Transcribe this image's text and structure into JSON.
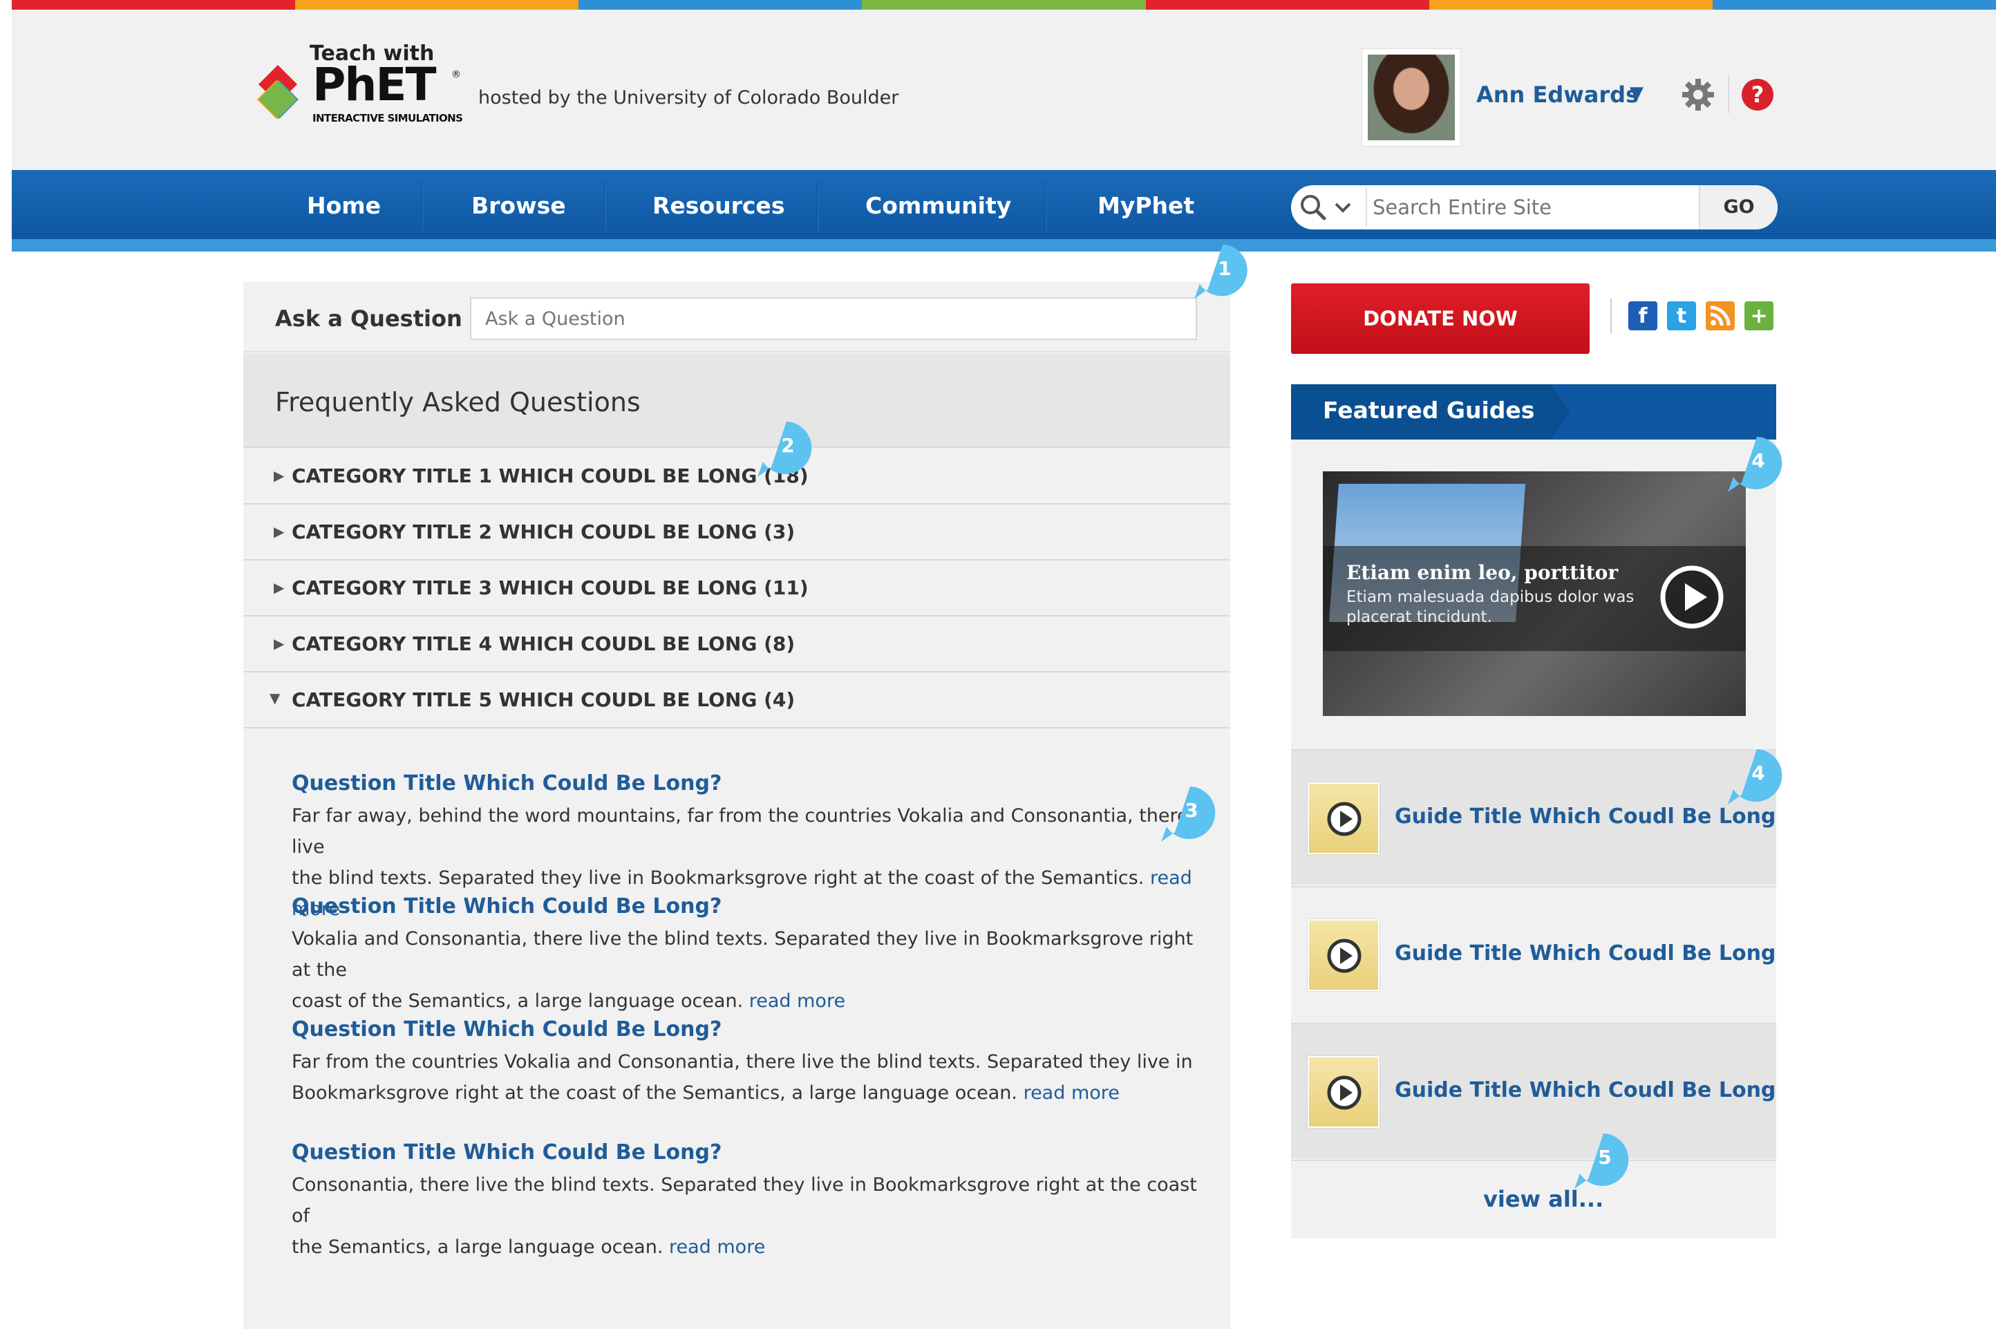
{
  "stripe_colors": [
    "#e2232b",
    "#f7a21b",
    "#2f8fd6",
    "#7ab842",
    "#e2232b",
    "#f7a21b",
    "#2f8fd6"
  ],
  "header": {
    "teach_with": "Teach with",
    "phet": "PhET",
    "reg": "®",
    "sub": "INTERACTIVE SIMULATIONS",
    "hosted_by": "hosted by the University of Colorado Boulder",
    "user_name": "Ann Edwards",
    "user_caret": "▼",
    "help": "?"
  },
  "nav": {
    "items": [
      "Home",
      "Browse",
      "Resources",
      "Community",
      "MyPhet"
    ],
    "search_placeholder": "Search Entire Site",
    "go": "GO"
  },
  "ask": {
    "label": "Ask a Question",
    "placeholder": "Ask a Question"
  },
  "faq": {
    "title": "Frequently Asked Questions",
    "categories": [
      {
        "title": "CATEGORY TITLE 1 WHICH COUDL BE LONG (18)",
        "expanded": false
      },
      {
        "title": "CATEGORY TITLE 2 WHICH COUDL BE LONG (3)",
        "expanded": false
      },
      {
        "title": "CATEGORY TITLE 3 WHICH COUDL BE LONG (11)",
        "expanded": false
      },
      {
        "title": "CATEGORY TITLE 4 WHICH COUDL BE LONG (8)",
        "expanded": false
      },
      {
        "title": "CATEGORY TITLE 5 WHICH COUDL BE LONG (4)",
        "expanded": true
      }
    ],
    "questions": [
      {
        "title": "Question Title Which Could Be Long?",
        "body_line1": "Far far away, behind the word mountains, far from the countries Vokalia and Consonantia, there live",
        "body_line2": "the blind texts. Separated they live in Bookmarksgrove right at the coast of the Semantics.",
        "more": "read more"
      },
      {
        "title": "Question Title Which Could Be Long?",
        "body_line1": "Vokalia and Consonantia, there live the blind texts. Separated they live in Bookmarksgrove right at the",
        "body_line2": "coast of the Semantics, a large language ocean.",
        "more": "read more"
      },
      {
        "title": "Question Title Which Could Be Long?",
        "body_line1": "Far from the countries Vokalia and Consonantia, there live the blind texts. Separated they live in",
        "body_line2": "Bookmarksgrove right at the coast of the Semantics, a large language ocean.",
        "more": "read more"
      },
      {
        "title": "Question Title Which Could Be Long?",
        "body_line1": "Consonantia, there live the blind texts. Separated they live in Bookmarksgrove right at the coast of",
        "body_line2": "the Semantics, a large language ocean.",
        "more": "read more"
      }
    ]
  },
  "sidebar": {
    "donate": "DONATE NOW",
    "social_icons": [
      "facebook-icon",
      "twitter-icon",
      "rss-icon",
      "plus-icon"
    ],
    "social_glyphs": [
      "f",
      "t",
      "",
      "+"
    ],
    "featured_title": "Featured Guides",
    "video": {
      "title": "Etiam enim leo, porttitor",
      "desc": "Etiam malesuada dapibus dolor was placerat tincidunt."
    },
    "guides": [
      "Guide Title Which Coudl Be Long",
      "Guide Title Which Coudl Be Long",
      "Guide Title Which Coudl Be Long"
    ],
    "view_all": "view all..."
  },
  "callouts": [
    "1",
    "2",
    "3",
    "4",
    "4",
    "5"
  ]
}
